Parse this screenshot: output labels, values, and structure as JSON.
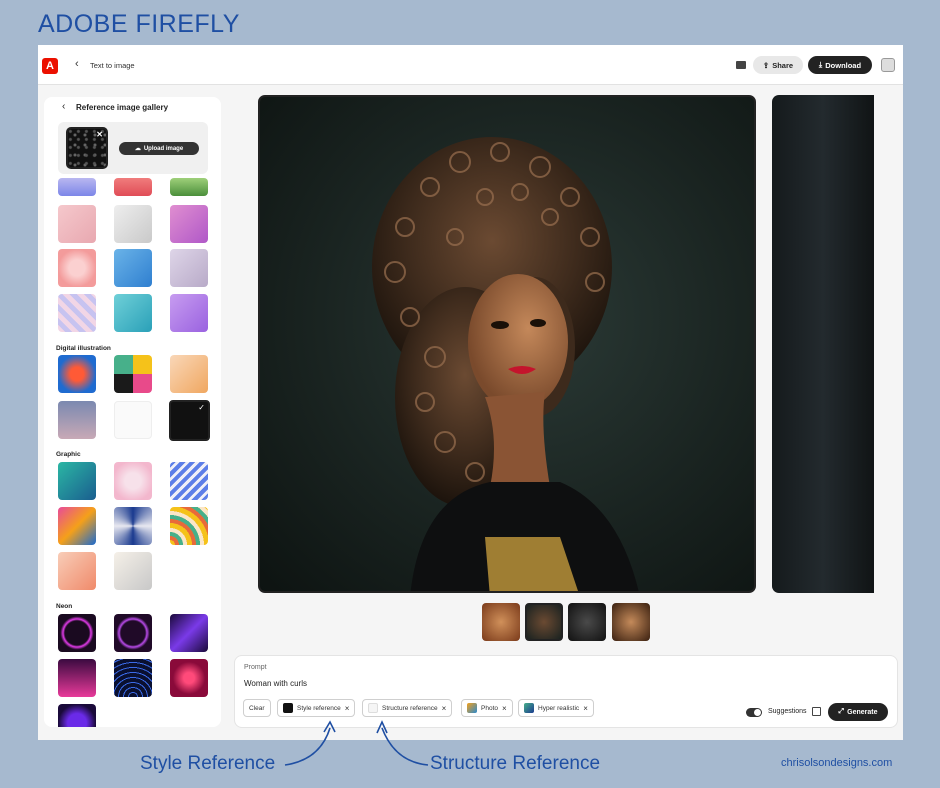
{
  "page_heading": "ADOBE FIREFLY",
  "topbar": {
    "breadcrumb": "Text to image",
    "share_label": "Share",
    "download_label": "Download",
    "logo_letter": "A"
  },
  "sidebar": {
    "title": "Reference image gallery",
    "upload_label": "Upload image",
    "categories": [
      "Digital illustration",
      "Graphic",
      "Neon"
    ]
  },
  "prompt": {
    "label": "Prompt",
    "text": "Woman with curls",
    "clear_label": "Clear",
    "chips": [
      "Style reference",
      "Structure reference",
      "Photo",
      "Hyper realistic"
    ],
    "suggestions_label": "Suggestions",
    "generate_label": "Generate"
  },
  "annotations": {
    "style_reference": "Style Reference",
    "structure_reference": "Structure Reference",
    "credit": "chrisolsondesigns.com"
  },
  "colors": {
    "page_bg": "#a6b9cf",
    "accent_text": "#1f4fa3",
    "adobe_red": "#eb1000"
  },
  "icons": {
    "logo": "adobe-logo-icon",
    "back": "chevron-left-icon",
    "comment": "comment-icon",
    "share": "share-icon",
    "download": "download-icon",
    "upload": "cloud-upload-icon",
    "generate": "generate-icon"
  }
}
